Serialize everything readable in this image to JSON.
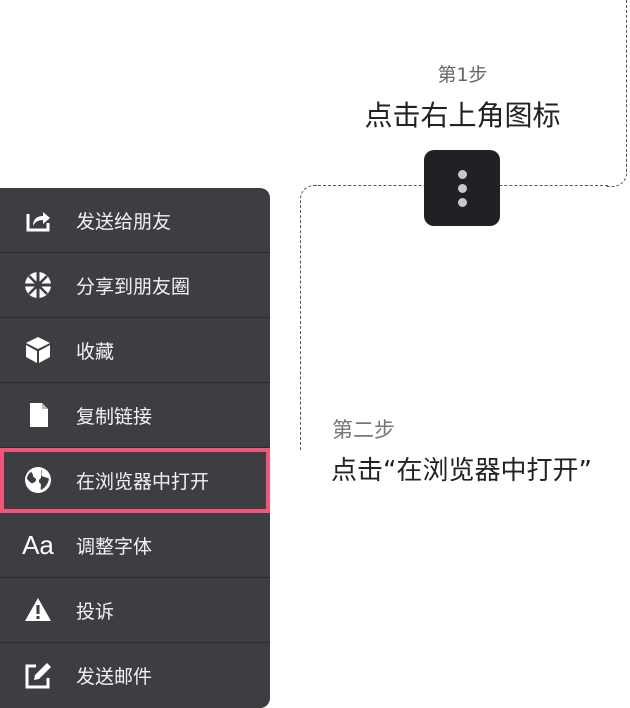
{
  "step1": {
    "title": "第1步",
    "text": "点击右上角图标"
  },
  "step2": {
    "title": "第二步",
    "text": "点击“在浏览器中打开”"
  },
  "menu": {
    "items": [
      {
        "label": "发送给朋友",
        "icon": "share-icon"
      },
      {
        "label": "分享到朋友圈",
        "icon": "moments-icon"
      },
      {
        "label": "收藏",
        "icon": "favorite-cube-icon"
      },
      {
        "label": "复制链接",
        "icon": "copy-document-icon"
      },
      {
        "label": "在浏览器中打开",
        "icon": "globe-icon",
        "highlighted": true
      },
      {
        "label": "调整字体",
        "icon": "font-icon",
        "icon_text": "Aa"
      },
      {
        "label": "投诉",
        "icon": "warning-icon"
      },
      {
        "label": "发送邮件",
        "icon": "mail-edit-icon"
      }
    ]
  },
  "colors": {
    "highlight": "#f2557a",
    "menu_bg": "#3d3e42",
    "kebab_bg": "#1f2124"
  }
}
